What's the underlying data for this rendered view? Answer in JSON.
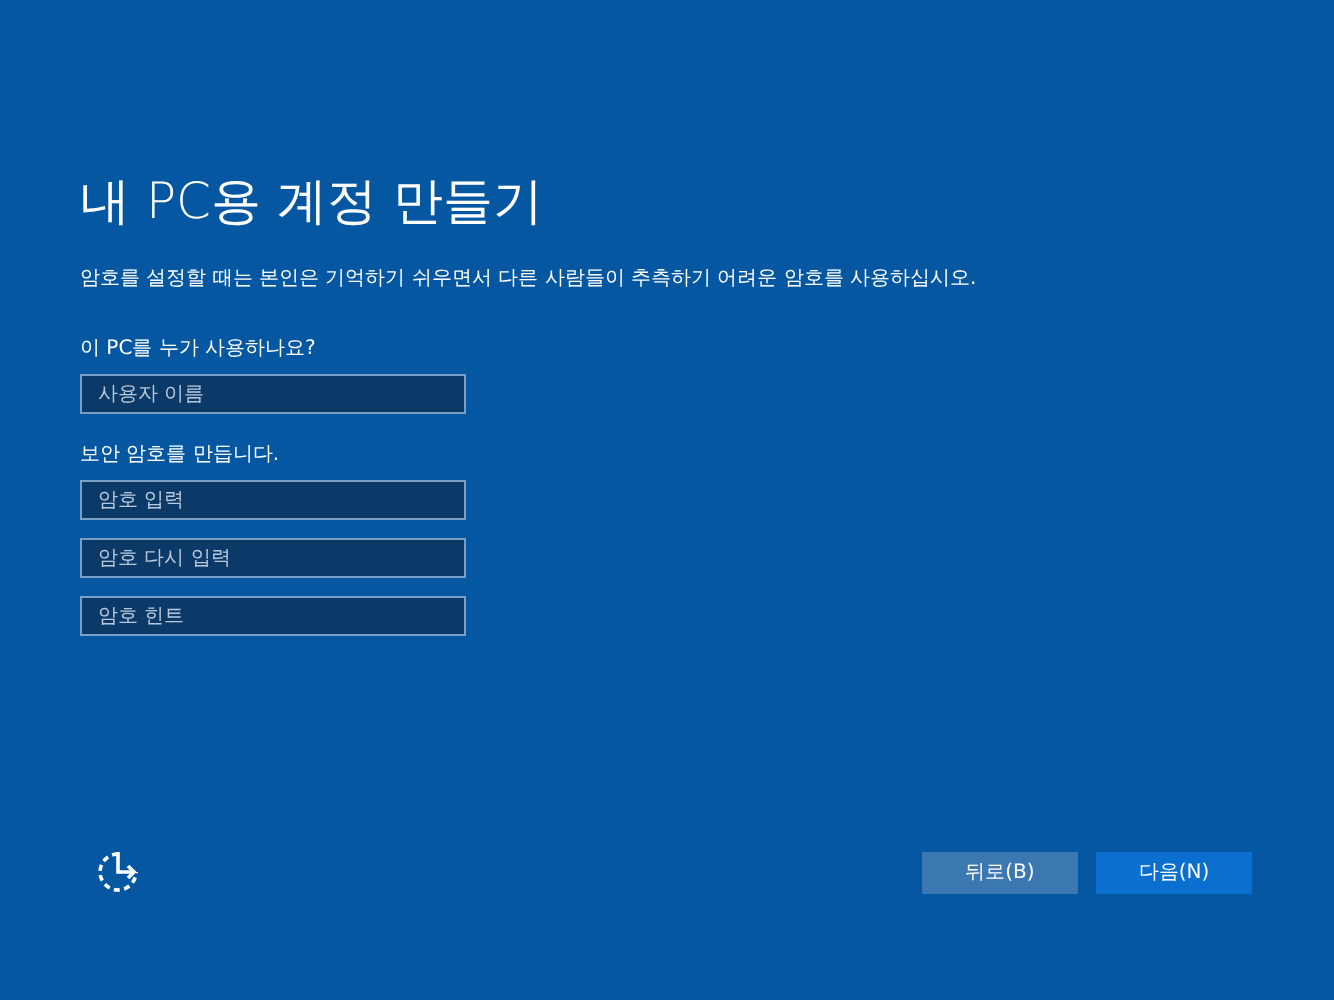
{
  "title": "내 PC용 계정 만들기",
  "description": "암호를 설정할 때는 본인은 기억하기 쉬우면서 다른 사람들이 추측하기 어려운 암호를 사용하십시오.",
  "sections": [
    {
      "label": "이 PC를 누가 사용하나요?",
      "fields": [
        {
          "placeholder": "사용자 이름"
        }
      ]
    },
    {
      "label": "보안 암호를 만듭니다.",
      "fields": [
        {
          "placeholder": "암호 입력"
        },
        {
          "placeholder": "암호 다시 입력"
        },
        {
          "placeholder": "암호 힌트"
        }
      ]
    }
  ],
  "buttons": [
    {
      "label": "뒤로(B)",
      "kind": "secondary"
    },
    {
      "label": "다음(N)",
      "kind": "primary"
    }
  ]
}
